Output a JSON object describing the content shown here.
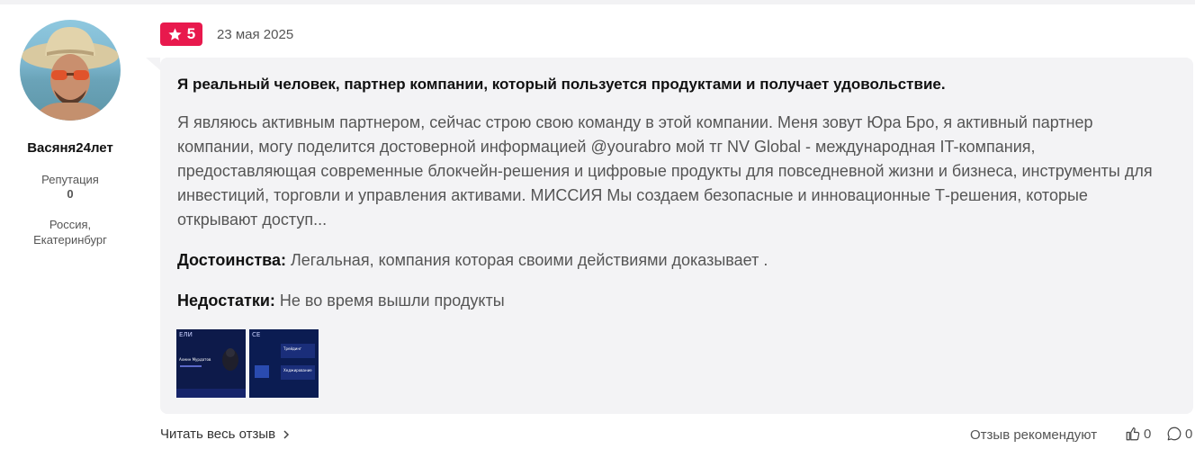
{
  "author": {
    "name": "Васяня24лет",
    "reputation_label": "Репутация",
    "reputation_value": "0",
    "location_line1": "Россия,",
    "location_line2": "Екатеринбург"
  },
  "review": {
    "rating": "5",
    "date": "23 мая 2025",
    "headline": "Я реальный человек, партнер компании, который пользуется продуктами и получает удовольствие.",
    "body": "Я являюсь активным партнером, сейчас строю свою команду в этой компании. Меня зовут Юра Бро, я активный партнер компании, могу поделится достоверной информацией @yourabro мой тг NV Global - международная IT-компания, предоставляющая современные блокчейн-решения и цифровые продукты для повседневной жизни и бизнеса, инструменты для инвестиций, торговли и управления активами. МИССИЯ Мы создаем безопасные и инновационные Т-решения, которые открывают доступ...",
    "pros_label": "Достоинства:",
    "pros_text": " Легальная, компания которая своими действиями доказывает .",
    "cons_label": "Недостатки:",
    "cons_text": " Не во время вышли продукты"
  },
  "thumbnails": [
    {
      "caption": "ЕЛИ",
      "person": "Ахмин Мурдатов"
    },
    {
      "caption": "CE",
      "line1": "Трейдинг",
      "line2": "Хеджирование"
    }
  ],
  "footer": {
    "read_more": "Читать весь отзыв",
    "recommend_label": "Отзыв рекомендуют",
    "likes": "0",
    "comments": "0"
  },
  "colors": {
    "rating_badge": "#e8194d",
    "bubble": "#f3f3f5"
  },
  "icons": [
    "star-icon",
    "chevron-right-icon",
    "thumbs-up-icon",
    "comment-icon"
  ]
}
